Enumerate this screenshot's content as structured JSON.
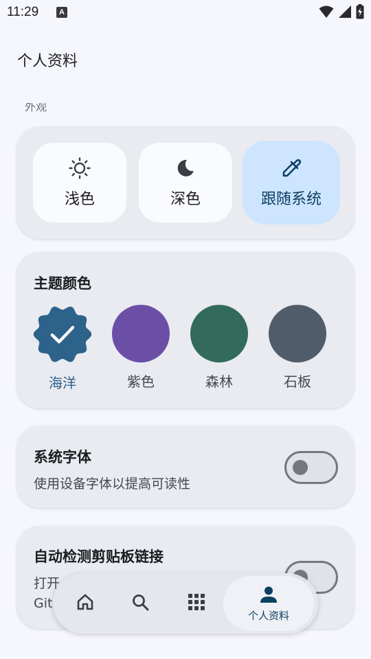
{
  "status_bar": {
    "time": "11:29",
    "notification_icon": "A",
    "icons": [
      "wifi-icon",
      "signal-icon",
      "battery-charging-icon"
    ]
  },
  "header": {
    "title": "个人资料"
  },
  "appearance": {
    "section_label": "外观",
    "modes": [
      {
        "label": "浅色",
        "icon": "sun-icon",
        "selected": false
      },
      {
        "label": "深色",
        "icon": "moon-icon",
        "selected": false
      },
      {
        "label": "跟随系统",
        "icon": "eyedropper-icon",
        "selected": true
      }
    ]
  },
  "theme_color": {
    "heading": "主题颜色",
    "swatches": [
      {
        "label": "海洋",
        "color": "#2d628b",
        "selected": true
      },
      {
        "label": "紫色",
        "color": "#6b4fa6",
        "selected": false
      },
      {
        "label": "森林",
        "color": "#326b59",
        "selected": false
      },
      {
        "label": "石板",
        "color": "#515c6b",
        "selected": false
      }
    ]
  },
  "system_font": {
    "title": "系统字体",
    "subtitle": "使用设备字体以提高可读性",
    "enabled": false
  },
  "clipboard": {
    "title": "自动检测剪贴板链接",
    "subtitle_line1": "打开",
    "subtitle_line2": "Git",
    "enabled": false
  },
  "bottom_nav": {
    "items": [
      {
        "icon": "home-icon",
        "label": ""
      },
      {
        "icon": "search-icon",
        "label": ""
      },
      {
        "icon": "apps-grid-icon",
        "label": ""
      },
      {
        "icon": "person-icon",
        "label": "个人资料",
        "active": true
      }
    ]
  },
  "colors": {
    "accent": "#2d628b",
    "selected_container": "#cde5ff",
    "card_bg": "#e9ebf1",
    "page_bg": "#f6f7fd"
  }
}
